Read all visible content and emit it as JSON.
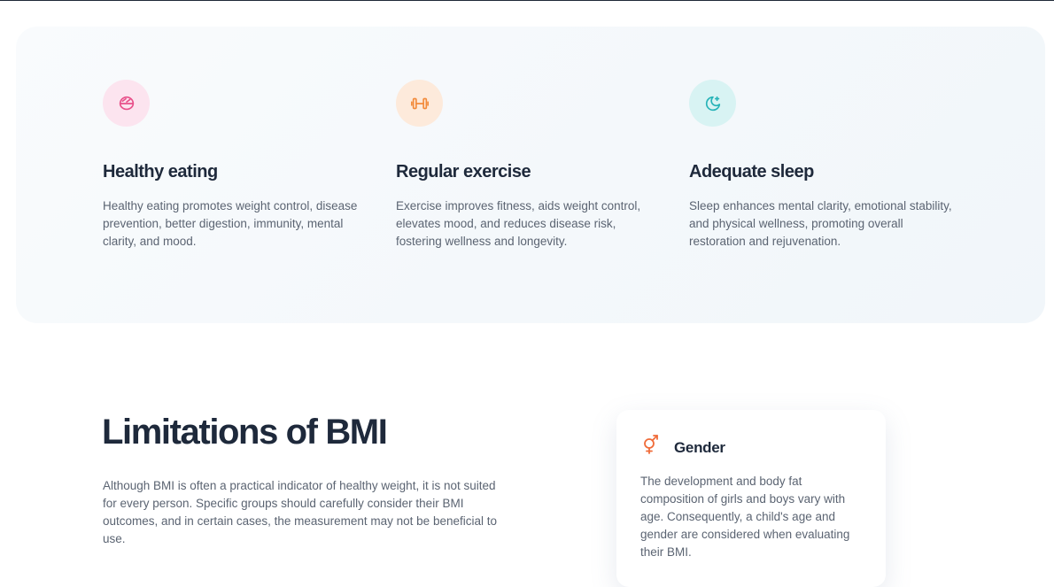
{
  "features": [
    {
      "icon": "bowl-icon",
      "title": "Healthy eating",
      "text": "Healthy eating promotes weight control, disease prevention, better digestion, immunity, mental clarity, and mood.",
      "icon_bg": "#fce4ef",
      "icon_color": "#e8508a"
    },
    {
      "icon": "dumbbell-icon",
      "title": "Regular exercise",
      "text": "Exercise improves fitness, aids weight control, elevates mood, and reduces disease risk, fostering wellness and longevity.",
      "icon_bg": "#fdeadb",
      "icon_color": "#f28b3c"
    },
    {
      "icon": "moon-stars-icon",
      "title": "Adequate sleep",
      "text": "Sleep enhances mental clarity, emotional stability, and physical wellness, promoting overall restoration and rejuvenation.",
      "icon_bg": "#d8f3f3",
      "icon_color": "#27b3b8"
    }
  ],
  "limitations": {
    "title": "Limitations of BMI",
    "text": "Although BMI is often a practical indicator of healthy weight, it is not suited for every person. Specific groups should carefully consider their BMI outcomes, and in certain cases, the measurement may not be beneficial to use."
  },
  "gender_card": {
    "icon": "gender-icon",
    "icon_color": "#f06c3a",
    "title": "Gender",
    "text": "The development and body fat composition of girls and boys vary with age. Consequently, a child's age and gender are considered when evaluating their BMI."
  }
}
